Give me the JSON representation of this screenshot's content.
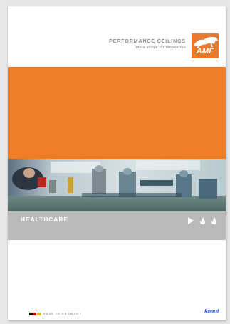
{
  "header": {
    "tagline_title": "PERFORMANCE CEILINGS",
    "tagline_subtitle": "More scope for innovation"
  },
  "logo": {
    "text": "AMF",
    "icon": "leaping-tiger-icon",
    "color": "#e8792b"
  },
  "banner": {
    "accent_color": "#ee7d28"
  },
  "photo": {
    "icon": "operating-theatre-photo"
  },
  "section": {
    "title": "HEALTHCARE",
    "band_color": "#b9b9b9",
    "icons": [
      "play-icon",
      "flame-icon",
      "flame-icon"
    ]
  },
  "footer": {
    "flag_icon": "german-flag-icon",
    "flag_colors": [
      "#111111",
      "#d40000",
      "#f2b800"
    ],
    "made_in": "MADE IN GERMANY",
    "brand": "knauf",
    "brand_color": "#2a5bd7"
  }
}
